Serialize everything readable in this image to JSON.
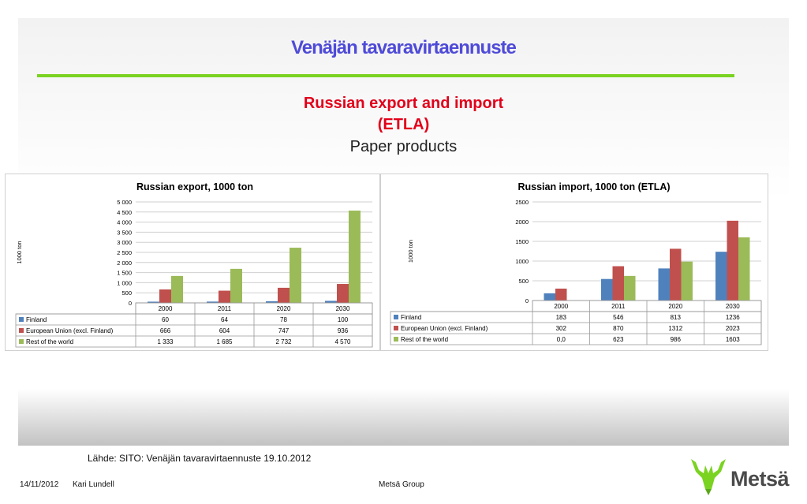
{
  "slide": {
    "title": "Venäjän tavaravirtaennuste",
    "subtitle_line1": "Russian export and import",
    "subtitle_line2": "(ETLA)",
    "subtitle_line3": "Paper products"
  },
  "footer": {
    "source": "Lähde: SITO: Venäjän tavaravirtaennuste 19.10.2012",
    "date": "14/11/2012",
    "author": "Kari Lundell",
    "company": "Metsä Group",
    "logo_text": "Metsä"
  },
  "colors": {
    "finland": "#4f81bd",
    "eu": "#c0504d",
    "rest": "#9bbb59",
    "accent": "#7ad321",
    "title": "#4f4bd8",
    "subtitle": "#e2001a"
  },
  "chart_data": [
    {
      "type": "bar",
      "title": "Russian export, 1000 ton",
      "ylabel": "1000 ton",
      "categories": [
        "2000",
        "2011",
        "2020",
        "2030"
      ],
      "ylim": [
        0,
        5000
      ],
      "yticks": [
        "5 000",
        "4 500",
        "4 000",
        "3 500",
        "3 000",
        "2 500",
        "2 000",
        "1 500",
        "1 000",
        "500",
        "0"
      ],
      "series": [
        {
          "name": "Finland",
          "values": [
            60,
            64,
            78,
            100
          ],
          "labels": [
            "60",
            "64",
            "78",
            "100"
          ]
        },
        {
          "name": "European Union (excl.  Finland)",
          "values": [
            666,
            604,
            747,
            936
          ],
          "labels": [
            "666",
            "604",
            "747",
            "936"
          ]
        },
        {
          "name": "Rest of the world",
          "values": [
            1333,
            1685,
            2732,
            4570
          ],
          "labels": [
            "1 333",
            "1 685",
            "2 732",
            "4 570"
          ]
        }
      ],
      "grid": true,
      "legend": "data-table"
    },
    {
      "type": "bar",
      "title": "Russian import, 1000 ton (ETLA)",
      "ylabel": "1000 ton",
      "categories": [
        "2000",
        "2011",
        "2020",
        "2030"
      ],
      "ylim": [
        0,
        2500
      ],
      "yticks": [
        "2500",
        "2000",
        "1500",
        "1000",
        "500",
        "0"
      ],
      "series": [
        {
          "name": "Finland",
          "values": [
            183,
            546,
            813,
            1236
          ],
          "labels": [
            "183",
            "546",
            "813",
            "1236"
          ]
        },
        {
          "name": "European Union (excl.  Finland)",
          "values": [
            302,
            870,
            1312,
            2023
          ],
          "labels": [
            "302",
            "870",
            "1312",
            "2023"
          ]
        },
        {
          "name": "Rest of the world",
          "values": [
            0,
            623,
            986,
            1603
          ],
          "labels": [
            "0,0",
            "623",
            "986",
            "1603"
          ]
        }
      ],
      "grid": true,
      "legend": "data-table"
    }
  ]
}
